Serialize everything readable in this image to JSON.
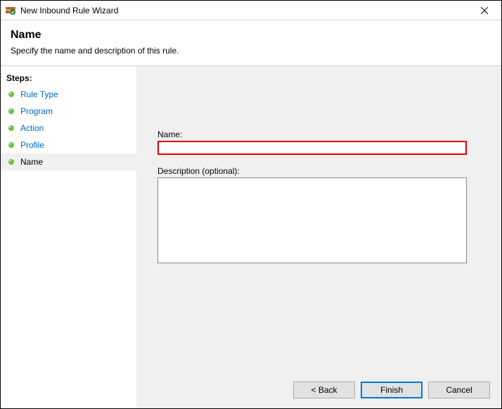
{
  "titlebar": {
    "title": "New Inbound Rule Wizard"
  },
  "header": {
    "title": "Name",
    "subtitle": "Specify the name and description of this rule."
  },
  "sidebar": {
    "header": "Steps:",
    "items": [
      {
        "label": "Rule Type"
      },
      {
        "label": "Program"
      },
      {
        "label": "Action"
      },
      {
        "label": "Profile"
      },
      {
        "label": "Name"
      }
    ]
  },
  "form": {
    "name_label": "Name:",
    "name_value": "",
    "desc_label": "Description (optional):",
    "desc_value": ""
  },
  "buttons": {
    "back": "< Back",
    "finish": "Finish",
    "cancel": "Cancel"
  }
}
